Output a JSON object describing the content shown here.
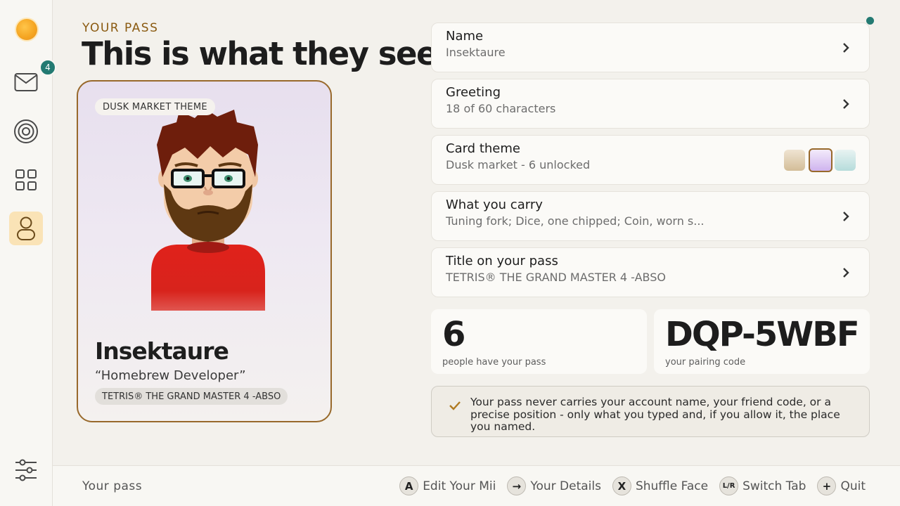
{
  "sidebar": {
    "mail_badge": "4",
    "items": [
      {
        "icon": "status-orb-icon"
      },
      {
        "icon": "mail-icon"
      },
      {
        "icon": "target-icon"
      },
      {
        "icon": "grid-icon"
      },
      {
        "icon": "person-icon",
        "active": true
      },
      {
        "icon": "sliders-icon"
      }
    ]
  },
  "header": {
    "eyebrow": "YOUR PASS",
    "title": "This is what they see"
  },
  "card": {
    "theme_chip": "DUSK MARKET THEME",
    "name": "Insektaure",
    "greeting": "“Homebrew Developer”",
    "title": "TETRIS® THE GRAND MASTER 4 -ABSO"
  },
  "details": {
    "name": {
      "label": "Name",
      "value": "Insektaure"
    },
    "greeting": {
      "label": "Greeting",
      "value": "18 of 60 characters"
    },
    "theme": {
      "label": "Card theme",
      "value": "Dusk market - 6 unlocked",
      "swatches": [
        "#d9c6a6",
        "#d7c2f1",
        "#bfe0df"
      ],
      "selected_swatch": 1
    },
    "carry": {
      "label": "What you carry",
      "value": "Tuning fork; Dice, one chipped; Coin, worn s..."
    },
    "title": {
      "label": "Title on your pass",
      "value": "TETRIS® THE GRAND MASTER 4 -ABSO"
    }
  },
  "stats": {
    "passes": {
      "value": "6",
      "label": "people have your pass"
    },
    "pairing": {
      "value": "DQP-5WBF",
      "label": "your pairing code"
    }
  },
  "note": {
    "text": "Your pass never carries your account name, your friend code, or a precise position - only what you typed and, if you allow it, the place you named."
  },
  "footer": {
    "title": "Your pass",
    "hints": [
      {
        "key": "A",
        "label": "Edit Your Mii"
      },
      {
        "key": "→",
        "label": "Your Details"
      },
      {
        "key": "X",
        "label": "Shuffle Face"
      },
      {
        "key": "L/R",
        "label": "Switch Tab"
      },
      {
        "key": "+",
        "label": "Quit"
      }
    ]
  },
  "colors": {
    "accent_teal": "#237a72",
    "card_border": "#98692b",
    "eyebrow": "#8a5a10",
    "active_nav": "#fae3b6"
  }
}
